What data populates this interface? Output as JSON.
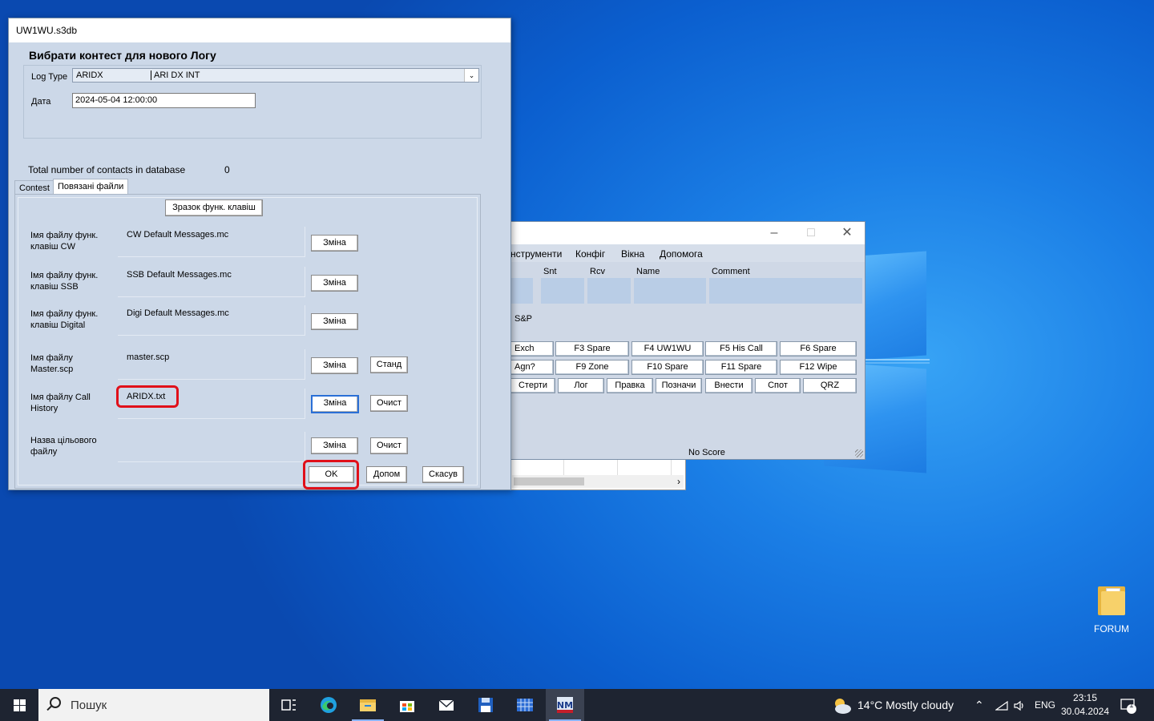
{
  "dialog": {
    "window_title": "UW1WU.s3db",
    "heading": "Вибрати контест для нового Логу",
    "log_type_label": "Log Type",
    "log_type_value1": "ARIDX",
    "log_type_value2": "ARI DX INT",
    "date_label": "Дата",
    "date_value": "2024-05-04 12:00:00",
    "total_label": "Total number of contacts in database",
    "total_value": "0",
    "tabs": [
      "Contest",
      "Повязані файли"
    ],
    "sample_button": "Зразок функ. клавіш",
    "rows": [
      {
        "label": "Імя файлу функ. клавіш CW",
        "file": "CW Default Messages.mc",
        "change": "Зміна"
      },
      {
        "label": "Імя файлу функ. клавіш SSB",
        "file": "SSB Default Messages.mc",
        "change": "Зміна"
      },
      {
        "label": "Імя файлу функ. клавіш Digital",
        "file": "Digi Default Messages.mc",
        "change": "Зміна"
      },
      {
        "label": "Імя файлу Master.scp",
        "file": "master.scp",
        "change": "Зміна",
        "extra": "Станд"
      },
      {
        "label": "Імя файлу Call History",
        "file": "ARIDX.txt",
        "change": "Зміна",
        "extra": "Очист"
      },
      {
        "label": "Назва цільового файлу",
        "file": "",
        "change": "Зміна",
        "extra": "Очист"
      }
    ],
    "ok": "OK",
    "help": "Допом",
    "cancel": "Скасув"
  },
  "main_window": {
    "menu": [
      "нструменти",
      "Конфіг",
      "Вікна",
      "Допомога"
    ],
    "columns": [
      "Snt",
      "Rcv",
      "Name",
      "Comment"
    ],
    "mode": "S&P",
    "fkeys_row1": [
      "Exch",
      "F3 Spare",
      "F4 UW1WU",
      "F5 His Call",
      "F6 Spare"
    ],
    "fkeys_row2": [
      "Agn?",
      "F9 Zone",
      "F10 Spare",
      "F11 Spare",
      "F12 Wipe"
    ],
    "fkeys_row3": [
      "Стерти",
      "Лог",
      "Правка",
      "Позначи",
      "Внести",
      "Спот",
      "QRZ"
    ],
    "score": "No Score"
  },
  "desktop": {
    "icon_label": "FORUM"
  },
  "taskbar": {
    "search_placeholder": "Пошук",
    "weather": "14°C  Mostly cloudy",
    "lang": "ENG",
    "time": "23:15",
    "date": "30.04.2024",
    "notif_count": "1"
  }
}
